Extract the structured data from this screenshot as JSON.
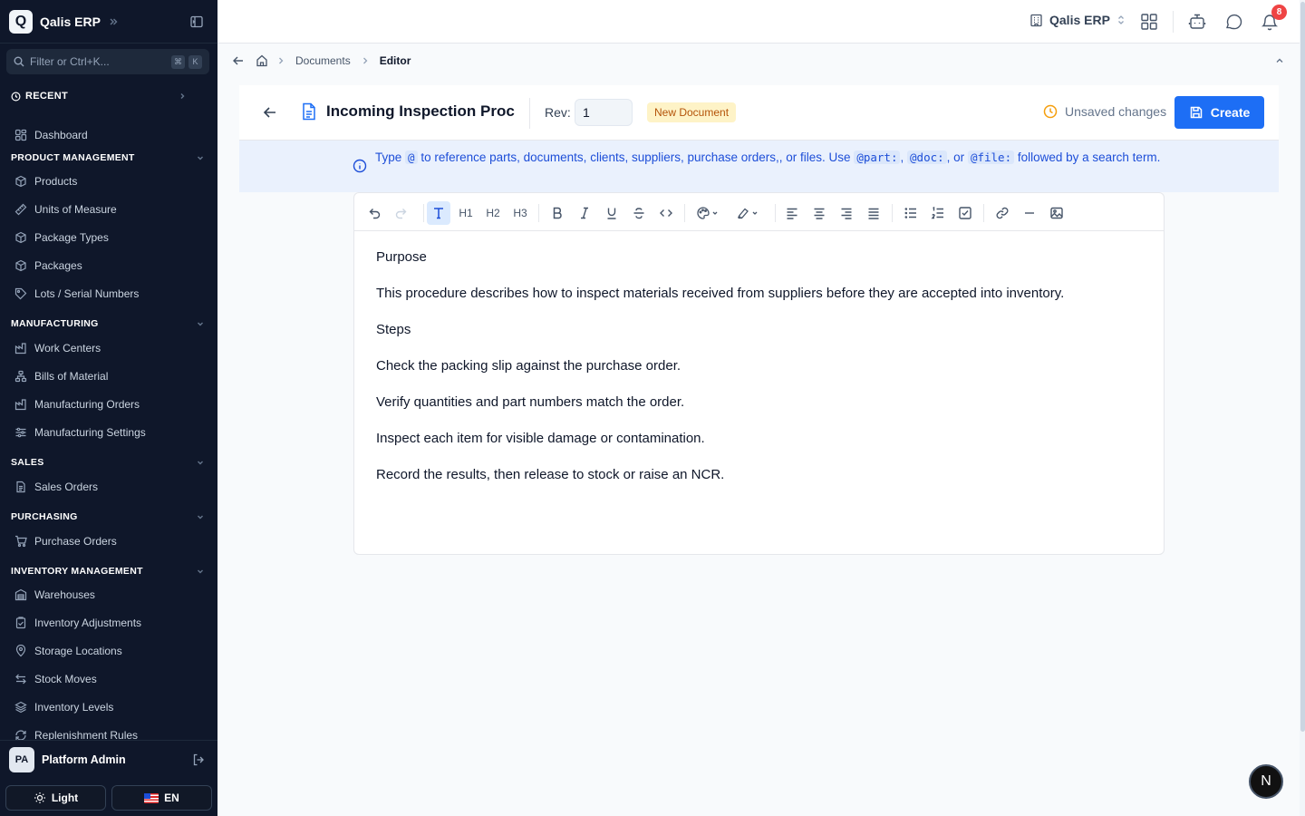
{
  "app": {
    "logo_letter": "Q",
    "brand": "Qalis ERP"
  },
  "sidebar": {
    "filter_placeholder": "Filter or Ctrl+K...",
    "kbd": [
      "⌘",
      "K"
    ],
    "recent_label": "RECENT",
    "dashboard": "Dashboard",
    "sections": [
      {
        "title": "PRODUCT MANAGEMENT",
        "items": [
          "Products",
          "Units of Measure",
          "Package Types",
          "Packages",
          "Lots / Serial Numbers"
        ]
      },
      {
        "title": "MANUFACTURING",
        "items": [
          "Work Centers",
          "Bills of Material",
          "Manufacturing Orders",
          "Manufacturing Settings"
        ]
      },
      {
        "title": "SALES",
        "items": [
          "Sales Orders"
        ]
      },
      {
        "title": "PURCHASING",
        "items": [
          "Purchase Orders"
        ]
      },
      {
        "title": "INVENTORY MANAGEMENT",
        "items": [
          "Warehouses",
          "Inventory Adjustments",
          "Storage Locations",
          "Stock Moves",
          "Inventory Levels",
          "Replenishment Rules"
        ]
      }
    ],
    "user": {
      "initials": "PA",
      "name": "Platform Admin"
    },
    "theme_label": "Light",
    "lang_label": "EN"
  },
  "topbar": {
    "company": "Qalis ERP",
    "notification_count": "8"
  },
  "breadcrumb": {
    "items": [
      "Documents"
    ],
    "current": "Editor"
  },
  "editor": {
    "title": "Incoming Inspection Proc",
    "rev_label": "Rev:",
    "rev_value": "1",
    "status_badge": "New Document",
    "unsaved_text": "Unsaved changes",
    "create_label": "Create"
  },
  "info": {
    "t1": "Type",
    "c1": "@",
    "t2": "to reference parts, documents, clients, suppliers, purchase orders,, or files. Use",
    "c2": "@part:",
    "t3": ",",
    "c3": "@doc:",
    "t4": ", or",
    "c4": "@file:",
    "t5": "followed by a search term."
  },
  "toolbar": {
    "h1": "H1",
    "h2": "H2",
    "h3": "H3"
  },
  "content": {
    "paragraphs": [
      "Purpose",
      "This procedure describes how to inspect materials received from suppliers before they are accepted into inventory.",
      "Steps",
      "Check the packing slip against the purchase order.",
      "Verify quantities and part numbers match the order.",
      "Inspect each item for visible damage or contamination.",
      "Record the results, then release to stock or raise an NCR."
    ]
  },
  "floating_badge": "N",
  "colors": {
    "sidebar_bg": "#0f172a",
    "accent": "#1d6ef5",
    "info_bg": "#eaf1fd",
    "badge_bg": "#ef4444",
    "status_badge_bg": "#fef3c7"
  }
}
